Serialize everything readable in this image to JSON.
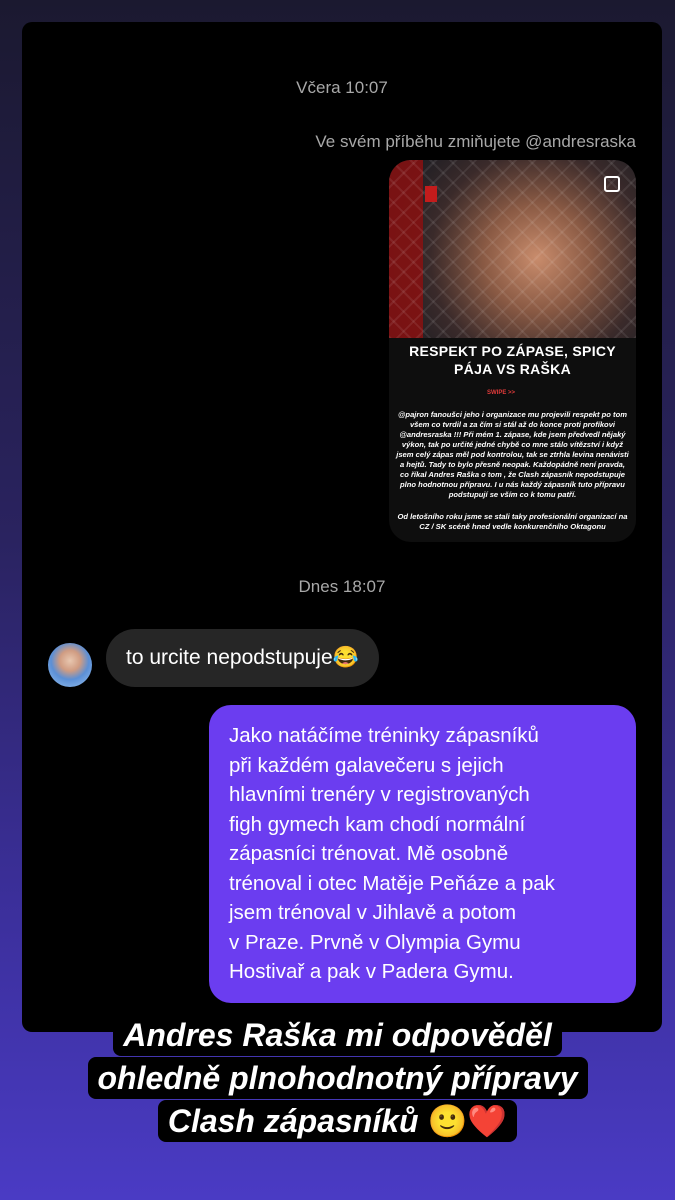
{
  "thread": {
    "timestamp_1": "Včera 10:07",
    "story_mention": "Ve svém příběhu zmiňujete @andresraska",
    "timestamp_2": "Dnes 18:07"
  },
  "story": {
    "title_line1": "RESPEKT PO ZÁPASE, SPICY",
    "title_line2": "PÁJA VS RAŠKA",
    "swipe": "SWIPE >>",
    "body": "@pajron fanoušci jeho i organizace mu projevili respekt po tom všem co tvrdil a za čím si stál až do konce proti profíkovi @andresraska !!! Při mém 1. zápase, kde jsem předvedl nějaký výkon, tak po určité jedné chybě co mne stálo vítězství i když jsem celý zápas měl pod kontrolou, tak se ztrhla levina nenávisti a hejtů. Tady to bylo přesně neopak. Každopádně není pravda, co říkal Andres Raška o tom , že Clash zápasník nepodstupuje plno hodnotnou přípravu. I u nás každý zápasník tuto přípravu podstupují se vším co k tomu patří.",
    "body2": "Od letošního roku jsme se stali taky profesionální organizací na CZ / SK scéně hned vedle konkurenčního Oktagonu",
    "icon": "square-outline-icon"
  },
  "messages": {
    "incoming": "to urcite nepodstupuje😂",
    "outgoing_lines": [
      "Jako natáčíme tréninky zápasníků",
      "při každém galavečeru s jejich",
      "hlavními trenéry v registrovaných",
      "figh gymech kam chodí normální",
      "zápasníci trénovat. Mě osobně",
      "trénoval i otec Matěje Peňáze a pak",
      "jsem trénoval v Jihlavě a potom",
      "v Praze. Prvně v Olympia Gymu",
      "Hostivař a pak v Padera Gymu."
    ]
  },
  "caption": {
    "line1": "Andres Raška mi odpověděl",
    "line2": "ohledně plnohodnotný přípravy",
    "line3": "Clash zápasníků",
    "emoji1": "🙂",
    "emoji2": "❤️"
  },
  "colors": {
    "outgoing_bubble": "#6b3df0",
    "incoming_bubble": "#262626",
    "background_gradient_bottom": "#4a3bc4"
  }
}
